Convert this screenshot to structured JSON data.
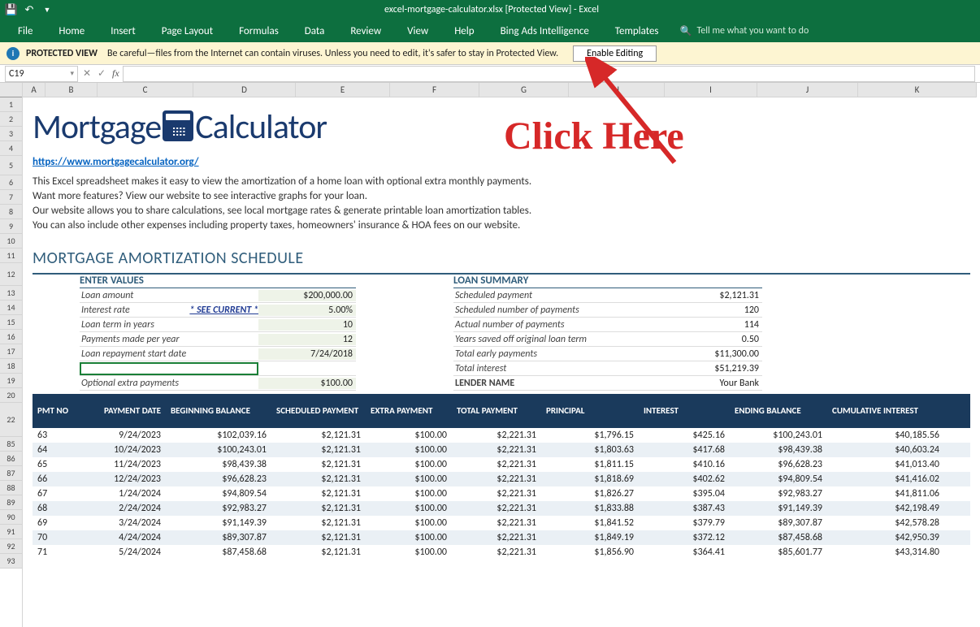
{
  "title": "excel-mortgage-calculator.xlsx  [Protected View]  -  Excel",
  "ribbon": [
    "File",
    "Home",
    "Insert",
    "Page Layout",
    "Formulas",
    "Data",
    "Review",
    "View",
    "Help",
    "Bing Ads Intelligence",
    "Templates"
  ],
  "search_placeholder": "Tell me what you want to do",
  "protect": {
    "label": "PROTECTED VIEW",
    "msg": "Be careful—files from the Internet can contain viruses. Unless you need to edit, it's safer to stay in Protected View.",
    "btn": "Enable Editing"
  },
  "namebox": "C19",
  "logo": {
    "part1": "Mortgage",
    "part2": "Calculator"
  },
  "link": "https://www.mortgagecalculator.org/",
  "desc": [
    "This Excel spreadsheet makes it easy to view the amortization of a home loan with optional extra monthly payments.",
    "Want more features? View our website to see interactive graphs for your loan.",
    "Our website allows you to share calculations, see local mortgage rates & generate printable loan amortization tables.",
    "You can also include other expenses including property taxes, homeowners' insurance & HOA fees on our website."
  ],
  "section": "MORTGAGE AMORTIZATION SCHEDULE",
  "enter": {
    "title": "ENTER VALUES",
    "rows": [
      {
        "lbl": "Loan amount",
        "val": "$200,000.00",
        "shade": true
      },
      {
        "lbl": "Interest rate",
        "see": "* SEE CURRENT *",
        "val": "5.00%",
        "shade": true
      },
      {
        "lbl": "Loan term in years",
        "val": "10",
        "shade": true
      },
      {
        "lbl": "Payments made per year",
        "val": "12",
        "shade": true
      },
      {
        "lbl": "Loan repayment start date",
        "val": "7/24/2018",
        "shade": true
      },
      {
        "lbl": "",
        "val": "",
        "shade": false,
        "selected": true
      },
      {
        "lbl": "Optional extra payments",
        "val": "$100.00",
        "shade": true
      }
    ]
  },
  "summary": {
    "title": "LOAN SUMMARY",
    "rows": [
      {
        "lbl": "Scheduled payment",
        "val": "$2,121.31"
      },
      {
        "lbl": "Scheduled number of payments",
        "val": "120"
      },
      {
        "lbl": "Actual number of payments",
        "val": "114"
      },
      {
        "lbl": "Years saved off original loan term",
        "val": "0.50"
      },
      {
        "lbl": "Total early payments",
        "val": "$11,300.00"
      },
      {
        "lbl": "Total interest",
        "val": "$51,219.39"
      }
    ],
    "lender_lbl": "LENDER NAME",
    "lender_val": "Your Bank"
  },
  "tbl_hdr": [
    "PMT NO",
    "PAYMENT DATE",
    "BEGINNING BALANCE",
    "SCHEDULED PAYMENT",
    "EXTRA PAYMENT",
    "TOTAL PAYMENT",
    "PRINCIPAL",
    "INTEREST",
    "ENDING BALANCE",
    "CUMULATIVE INTEREST"
  ],
  "rows": [
    {
      "n": "63",
      "d": "9/24/2023",
      "bb": "$102,039.16",
      "sp": "$2,121.31",
      "ep": "$100.00",
      "tp": "$2,221.31",
      "pr": "$1,796.15",
      "in": "$425.16",
      "eb": "$100,243.01",
      "ci": "$40,185.56"
    },
    {
      "n": "64",
      "d": "10/24/2023",
      "bb": "$100,243.01",
      "sp": "$2,121.31",
      "ep": "$100.00",
      "tp": "$2,221.31",
      "pr": "$1,803.63",
      "in": "$417.68",
      "eb": "$98,439.38",
      "ci": "$40,603.24"
    },
    {
      "n": "65",
      "d": "11/24/2023",
      "bb": "$98,439.38",
      "sp": "$2,121.31",
      "ep": "$100.00",
      "tp": "$2,221.31",
      "pr": "$1,811.15",
      "in": "$410.16",
      "eb": "$96,628.23",
      "ci": "$41,013.40"
    },
    {
      "n": "66",
      "d": "12/24/2023",
      "bb": "$96,628.23",
      "sp": "$2,121.31",
      "ep": "$100.00",
      "tp": "$2,221.31",
      "pr": "$1,818.69",
      "in": "$402.62",
      "eb": "$94,809.54",
      "ci": "$41,416.02"
    },
    {
      "n": "67",
      "d": "1/24/2024",
      "bb": "$94,809.54",
      "sp": "$2,121.31",
      "ep": "$100.00",
      "tp": "$2,221.31",
      "pr": "$1,826.27",
      "in": "$395.04",
      "eb": "$92,983.27",
      "ci": "$41,811.06"
    },
    {
      "n": "68",
      "d": "2/24/2024",
      "bb": "$92,983.27",
      "sp": "$2,121.31",
      "ep": "$100.00",
      "tp": "$2,221.31",
      "pr": "$1,833.88",
      "in": "$387.43",
      "eb": "$91,149.39",
      "ci": "$42,198.49"
    },
    {
      "n": "69",
      "d": "3/24/2024",
      "bb": "$91,149.39",
      "sp": "$2,121.31",
      "ep": "$100.00",
      "tp": "$2,221.31",
      "pr": "$1,841.52",
      "in": "$379.79",
      "eb": "$89,307.87",
      "ci": "$42,578.28"
    },
    {
      "n": "70",
      "d": "4/24/2024",
      "bb": "$89,307.87",
      "sp": "$2,121.31",
      "ep": "$100.00",
      "tp": "$2,221.31",
      "pr": "$1,849.19",
      "in": "$372.12",
      "eb": "$87,458.68",
      "ci": "$42,950.39"
    },
    {
      "n": "71",
      "d": "5/24/2024",
      "bb": "$87,458.68",
      "sp": "$2,121.31",
      "ep": "$100.00",
      "tp": "$2,221.31",
      "pr": "$1,856.90",
      "in": "$364.41",
      "eb": "$85,601.77",
      "ci": "$43,314.80"
    }
  ],
  "rownums_top": [
    "1",
    "2",
    "3",
    "4",
    "5",
    "6",
    "7",
    "8",
    "9",
    "10",
    "11"
  ],
  "rownums_mid": [
    "12",
    "13",
    "14",
    "15",
    "16",
    "17",
    "18",
    "19",
    "20"
  ],
  "rownums_bot": [
    "22",
    "85",
    "86",
    "87",
    "88",
    "89",
    "90",
    "91",
    "92",
    "93"
  ],
  "cols": [
    "A",
    "B",
    "C",
    "D",
    "E",
    "F",
    "G",
    "H",
    "I",
    "J",
    "K"
  ],
  "annotation": "Click Here"
}
